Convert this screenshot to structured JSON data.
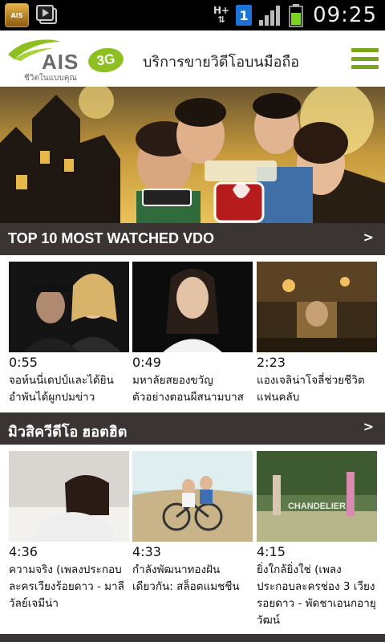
{
  "status_bar": {
    "time": "09:25",
    "network_type": "H+",
    "sim_badge": "1",
    "notification_app_label": "AIS"
  },
  "header": {
    "logo_brand": "AIS",
    "logo_badge": "3G",
    "logo_tagline": "ชีวิตในแบบคุณ",
    "title": "บริการขายวิดีโอบนมือถือ"
  },
  "sections": [
    {
      "title": "TOP 10 MOST WATCHED VDO",
      "arrow": ">",
      "items": [
        {
          "duration": "0:55",
          "caption": "จอห์นนี่เดปป์และได้ยินอำพันได้ผูกปมข่าว"
        },
        {
          "duration": "0:49",
          "caption": "มหาลัยสยองขวัญ ตัวอย่างตอนผีสนามบาส"
        },
        {
          "duration": "2:23",
          "caption": "แองเจลิน่าโจลี่ช่วยชีวิตแฟนคลับ"
        }
      ]
    },
    {
      "title": "มิวสิควีดีโอ ฮอตฮิต",
      "arrow": ">",
      "items": [
        {
          "duration": "4:36",
          "caption": "ความจริง (เพลงประกอบละครเวียงร้อยดาว - มาลีวัลย์เจมีน่า"
        },
        {
          "duration": "4:33",
          "caption": "กำลังพัฒนาทองฝันเดียวกัน: สล็อตแมชชีน"
        },
        {
          "duration": "4:15",
          "caption": "ยิ่งใกล้ยิ่งใช่ (เพลงประกอบละครช่อง 3 เวียงรอยดาว - พัดชาเอนกอายุวัฒน์",
          "thumb_text": "CHANDELIER"
        }
      ]
    }
  ],
  "colors": {
    "section_bar": "#3a3533",
    "brand_green": "#8cbf1f",
    "menu_green": "#7aa61a"
  }
}
